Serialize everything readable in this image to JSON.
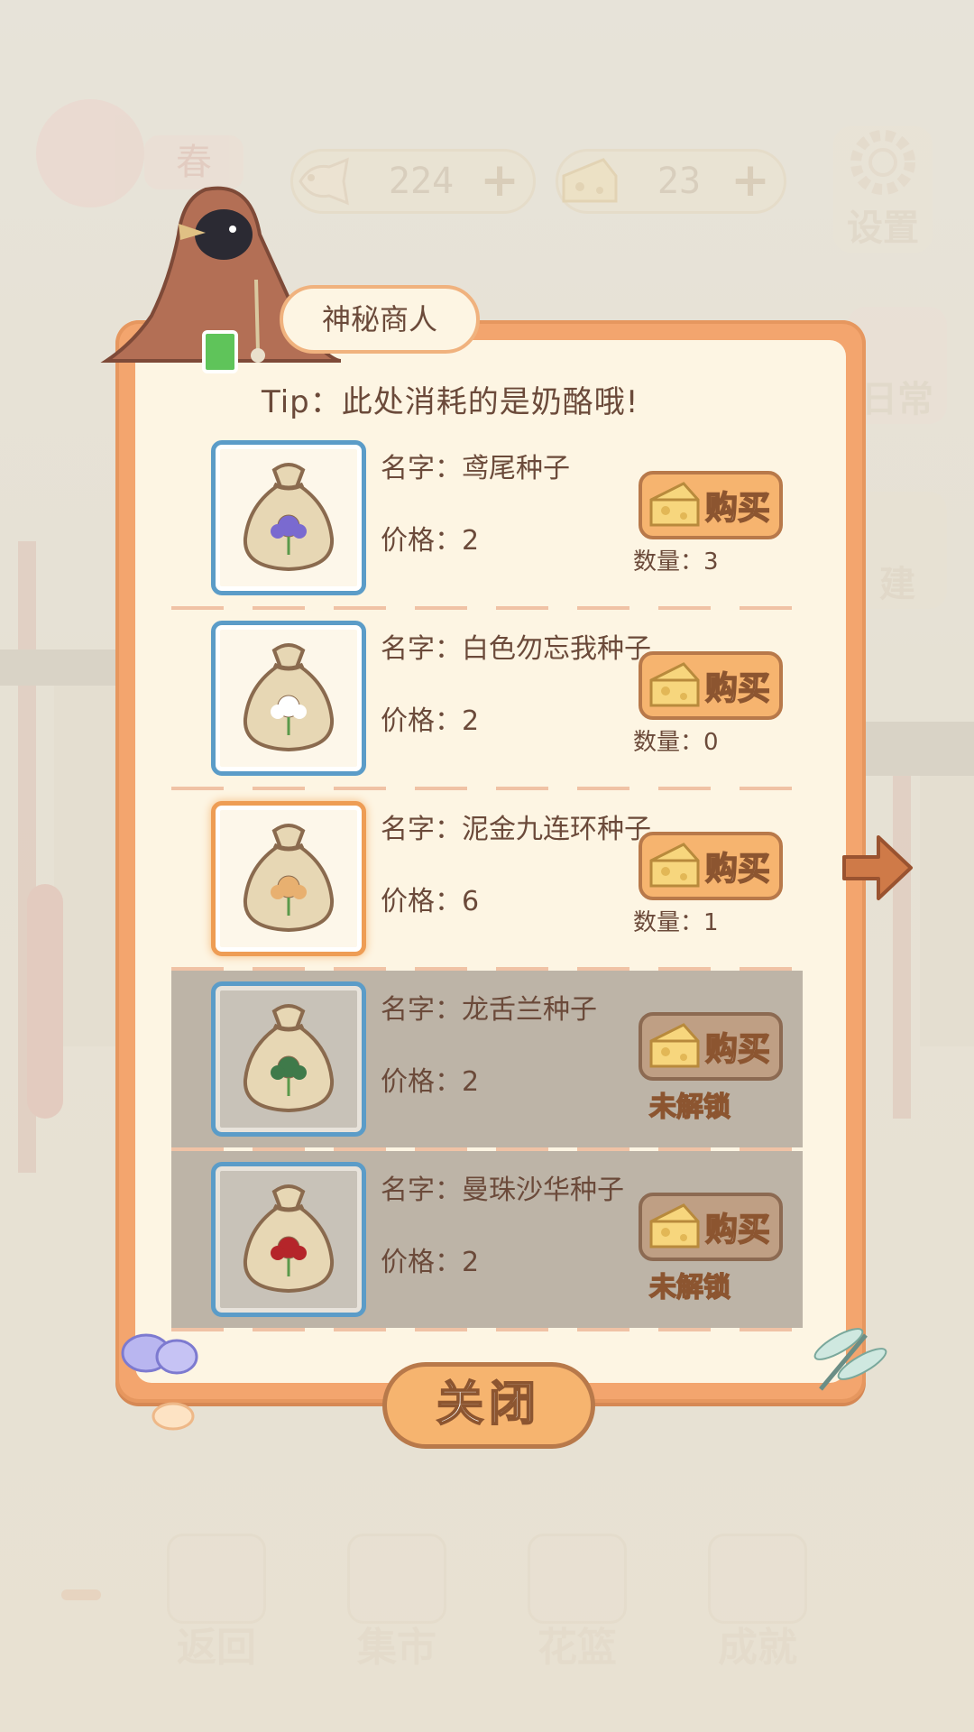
{
  "hud": {
    "season_label": "春",
    "fish_bone": {
      "value": "224",
      "plus": "+"
    },
    "cheese": {
      "value": "23",
      "plus": "+"
    },
    "settings_label": "设置",
    "side_buttons": [
      "日常",
      "建"
    ]
  },
  "bottom_nav": [
    "返回",
    "集市",
    "花篮",
    "成就"
  ],
  "shop": {
    "title": "神秘商人",
    "tip": "Tip：此处消耗的是奶酪哦!",
    "buy_label": "购买",
    "close_label": "关闭",
    "items": [
      {
        "name": "名字：鸢尾种子",
        "price": "价格：2",
        "status": "数量：3",
        "locked": false,
        "selected": false,
        "flower_color": "#7a6ad0"
      },
      {
        "name": "名字：白色勿忘我种子",
        "price": "价格：2",
        "status": "数量：0",
        "locked": false,
        "selected": false,
        "flower_color": "#ffffff"
      },
      {
        "name": "名字：泥金九连环种子",
        "price": "价格：6",
        "status": "数量：1",
        "locked": false,
        "selected": true,
        "flower_color": "#e8b070"
      },
      {
        "name": "名字：龙舌兰种子",
        "price": "价格：2",
        "status": "未解锁",
        "locked": true,
        "selected": false,
        "flower_color": "#3f7a4a"
      },
      {
        "name": "名字：曼珠沙华种子",
        "price": "价格：2",
        "status": "未解锁",
        "locked": true,
        "selected": false,
        "flower_color": "#b5252a"
      }
    ]
  }
}
